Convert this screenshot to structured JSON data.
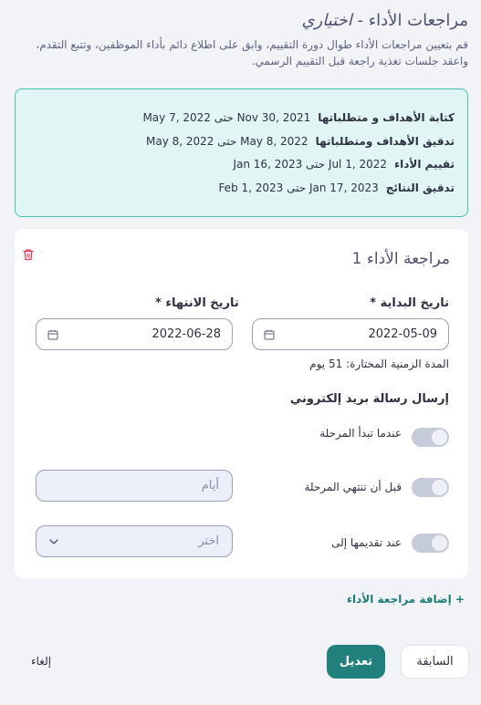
{
  "header": {
    "title": "مراجعات الأداء - ",
    "title_optional": "اختياري",
    "description": "قم بتعيين مراجعات الأداء طوال دورة التقييم، وابق على اطلاع دائم بأداء الموظفين، وتتبع التقدم، واعقد جلسات تغذية راجعة قبل التقييم الرسمي."
  },
  "summary": [
    {
      "label": "كتابة الأهداف و متطلباتها",
      "dates": "Nov 30, 2021 حتى May 7, 2022"
    },
    {
      "label": "تدقيق الأهداف ومتطلباتها",
      "dates": "May 8, 2022 حتى May 8, 2022"
    },
    {
      "label": "تقييم الأداء",
      "dates": "Jul 1, 2022 حتى Jan 16, 2023"
    },
    {
      "label": "تدقيق النتائج",
      "dates": "Jan 17, 2023 حتى Feb 1, 2023"
    }
  ],
  "review": {
    "title": "مراجعة الأداء 1",
    "start_label": "تاريخ البداية",
    "end_label": "تاريخ الانتهاء",
    "required_mark": "*",
    "start_value": "2022-05-09",
    "end_value": "2022-06-28",
    "duration": "المدة الزمنية المختارة: 51 يوم",
    "email_title": "إرسال رسالة بريد إلكتروني",
    "toggle_phase_start": "عندما تبدأ المرحلة",
    "toggle_before_end": "قبل أن تنتهي المرحلة",
    "days_placeholder": "أيام",
    "toggle_on_submit": "عند تقديمها إلى",
    "select_placeholder": "اختر"
  },
  "actions": {
    "add_review": "+ إضافة مراجعة الأداء",
    "previous": "السابقة",
    "edit": "تعديل",
    "cancel": "إلغاء"
  },
  "colors": {
    "accent": "#21807c",
    "summary_bg": "#e1f6f4",
    "summary_border": "#44c2b6",
    "danger": "#e0364f"
  }
}
